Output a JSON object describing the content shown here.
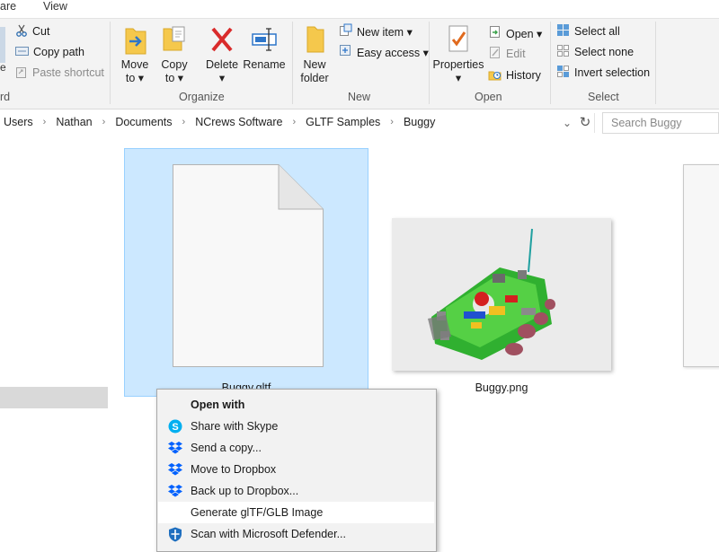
{
  "tabs": {
    "share": "are",
    "view": "View"
  },
  "ribbon": {
    "clipboard": {
      "cut": "Cut",
      "copy_path": "Copy path",
      "paste_shortcut": "Paste shortcut",
      "group_label": "rd"
    },
    "organize": {
      "move_to": [
        "Move",
        "to ▾"
      ],
      "copy_to": [
        "Copy",
        "to ▾"
      ],
      "delete": [
        "Delete",
        "▾"
      ],
      "rename": "Rename",
      "group_label": "Organize"
    },
    "new": {
      "new_folder": [
        "New",
        "folder"
      ],
      "new_item": "New item ▾",
      "easy_access": "Easy access ▾",
      "group_label": "New"
    },
    "open": {
      "properties": [
        "Properties",
        "▾"
      ],
      "open": "Open ▾",
      "edit": "Edit",
      "history": "History",
      "group_label": "Open"
    },
    "select": {
      "select_all": "Select all",
      "select_none": "Select none",
      "invert": "Invert selection",
      "group_label": "Select"
    }
  },
  "address": {
    "crumbs": [
      "Users",
      "Nathan",
      "Documents",
      "NCrews Software",
      "GLTF Samples",
      "Buggy"
    ],
    "separator": "›",
    "dropdown": "⌄",
    "refresh": "↻",
    "search_placeholder": "Search Buggy"
  },
  "files": [
    {
      "name": "Buggy.gltf",
      "selected": true
    },
    {
      "name": "Buggy.png",
      "selected": false
    }
  ],
  "context_menu": {
    "items": [
      {
        "label": "Open with",
        "icon": "none",
        "bold": true
      },
      {
        "label": "Share with Skype",
        "icon": "skype-icon"
      },
      {
        "label": "Send a copy...",
        "icon": "dropbox-icon"
      },
      {
        "label": "Move to Dropbox",
        "icon": "dropbox-icon"
      },
      {
        "label": "Back up to Dropbox...",
        "icon": "dropbox-icon"
      },
      {
        "label": "Generate glTF/GLB Image",
        "icon": "none",
        "hover": true
      },
      {
        "label": "Scan with Microsoft Defender...",
        "icon": "defender-icon"
      }
    ]
  },
  "colors": {
    "selection_fill": "#cce8ff",
    "selection_border": "#99d1ff",
    "accent": "#0078d7",
    "dropbox": "#0061fe",
    "skype": "#00aff0"
  }
}
